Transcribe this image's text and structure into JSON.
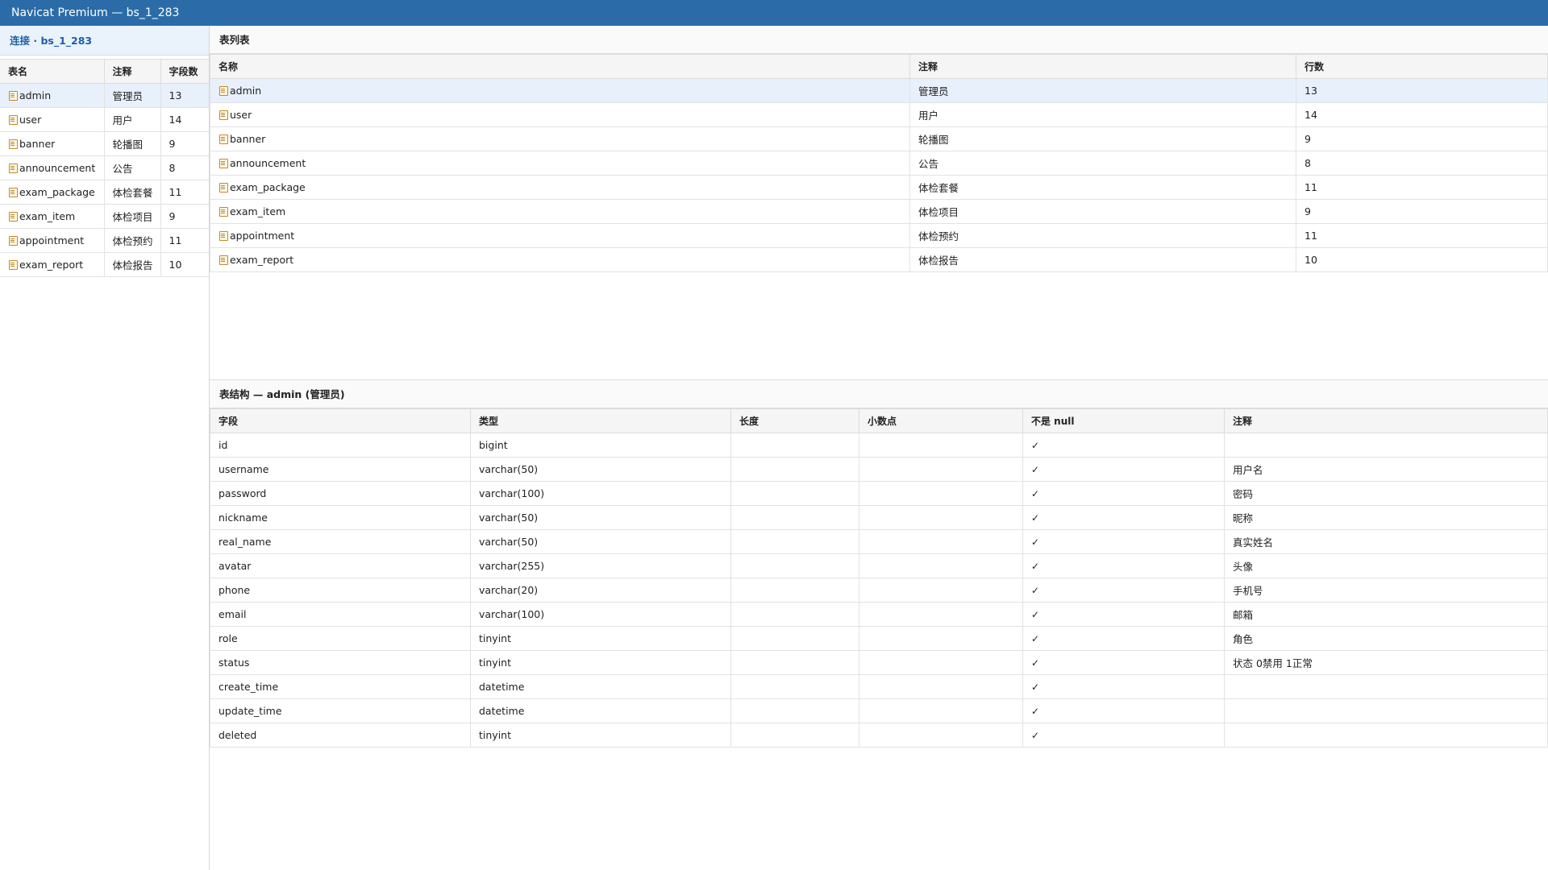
{
  "window": {
    "title": "Navicat Premium — bs_1_283"
  },
  "sidebar": {
    "connection_label": "连接 · bs_1_283",
    "columns": [
      "表名",
      "注释",
      "字段数"
    ],
    "rows": [
      {
        "name": "admin",
        "comment": "管理员",
        "count": "13"
      },
      {
        "name": "user",
        "comment": "用户",
        "count": "14"
      },
      {
        "name": "banner",
        "comment": "轮播图",
        "count": "9"
      },
      {
        "name": "announcement",
        "comment": "公告",
        "count": "8"
      },
      {
        "name": "exam_package",
        "comment": "体检套餐",
        "count": "11"
      },
      {
        "name": "exam_item",
        "comment": "体检项目",
        "count": "9"
      },
      {
        "name": "appointment",
        "comment": "体检预约",
        "count": "11"
      },
      {
        "name": "exam_report",
        "comment": "体检报告",
        "count": "10"
      }
    ]
  },
  "table_list": {
    "title": "表列表",
    "columns": [
      "名称",
      "注释",
      "行数"
    ],
    "rows": [
      {
        "name": "admin",
        "comment": "管理员",
        "rows": "13"
      },
      {
        "name": "user",
        "comment": "用户",
        "rows": "14"
      },
      {
        "name": "banner",
        "comment": "轮播图",
        "rows": "9"
      },
      {
        "name": "announcement",
        "comment": "公告",
        "rows": "8"
      },
      {
        "name": "exam_package",
        "comment": "体检套餐",
        "rows": "11"
      },
      {
        "name": "exam_item",
        "comment": "体检项目",
        "rows": "9"
      },
      {
        "name": "appointment",
        "comment": "体检预约",
        "rows": "11"
      },
      {
        "name": "exam_report",
        "comment": "体检报告",
        "rows": "10"
      }
    ]
  },
  "structure": {
    "title": "表结构 — admin (管理员)",
    "columns": [
      "字段",
      "类型",
      "长度",
      "小数点",
      "不是 null",
      "注释"
    ],
    "rows": [
      {
        "field": "id",
        "type": "bigint",
        "length": "",
        "decimals": "",
        "not_null": "✓",
        "comment": ""
      },
      {
        "field": "username",
        "type": "varchar(50)",
        "length": "",
        "decimals": "",
        "not_null": "✓",
        "comment": "用户名"
      },
      {
        "field": "password",
        "type": "varchar(100)",
        "length": "",
        "decimals": "",
        "not_null": "✓",
        "comment": "密码"
      },
      {
        "field": "nickname",
        "type": "varchar(50)",
        "length": "",
        "decimals": "",
        "not_null": "✓",
        "comment": "昵称"
      },
      {
        "field": "real_name",
        "type": "varchar(50)",
        "length": "",
        "decimals": "",
        "not_null": "✓",
        "comment": "真实姓名"
      },
      {
        "field": "avatar",
        "type": "varchar(255)",
        "length": "",
        "decimals": "",
        "not_null": "✓",
        "comment": "头像"
      },
      {
        "field": "phone",
        "type": "varchar(20)",
        "length": "",
        "decimals": "",
        "not_null": "✓",
        "comment": "手机号"
      },
      {
        "field": "email",
        "type": "varchar(100)",
        "length": "",
        "decimals": "",
        "not_null": "✓",
        "comment": "邮箱"
      },
      {
        "field": "role",
        "type": "tinyint",
        "length": "",
        "decimals": "",
        "not_null": "✓",
        "comment": "角色"
      },
      {
        "field": "status",
        "type": "tinyint",
        "length": "",
        "decimals": "",
        "not_null": "✓",
        "comment": "状态 0禁用 1正常"
      },
      {
        "field": "create_time",
        "type": "datetime",
        "length": "",
        "decimals": "",
        "not_null": "✓",
        "comment": ""
      },
      {
        "field": "update_time",
        "type": "datetime",
        "length": "",
        "decimals": "",
        "not_null": "✓",
        "comment": ""
      },
      {
        "field": "deleted",
        "type": "tinyint",
        "length": "",
        "decimals": "",
        "not_null": "✓",
        "comment": ""
      }
    ]
  },
  "colors": {
    "titlebar": "#2b6ca8",
    "connection_text": "#1f5fa8",
    "selected_row": "#e8f0fb"
  },
  "icons": {
    "table": "table-icon"
  }
}
